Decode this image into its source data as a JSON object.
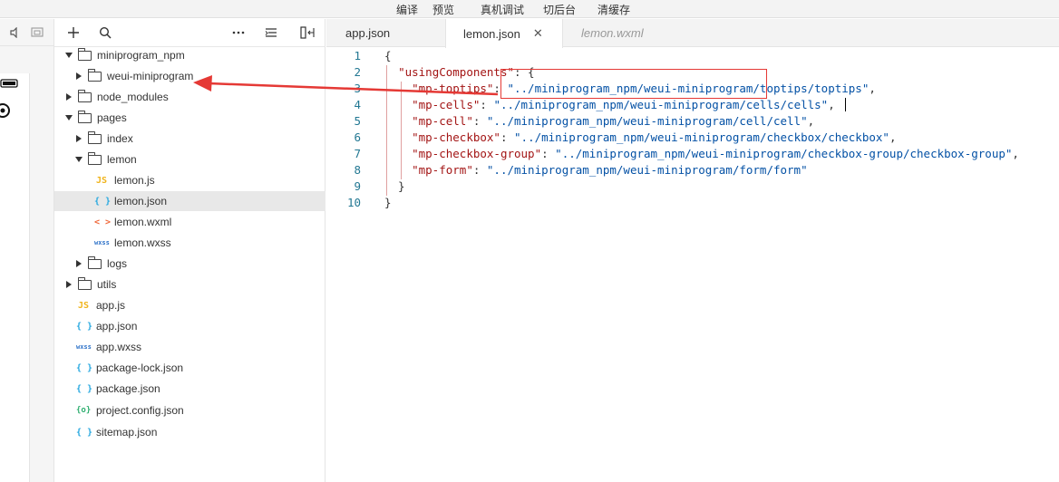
{
  "toolbar": {
    "compile": "编译",
    "preview": "预览",
    "remote_debug": "真机调试",
    "background": "切后台",
    "clear_cache": "清缓存"
  },
  "explorer": {
    "tree": [
      {
        "label": "miniprogram_npm",
        "kind": "folder",
        "expanded": true
      },
      {
        "label": "weui-miniprogram",
        "kind": "folder",
        "expanded": false
      },
      {
        "label": "node_modules",
        "kind": "folder",
        "expanded": false
      },
      {
        "label": "pages",
        "kind": "folder",
        "expanded": true
      },
      {
        "label": "index",
        "kind": "folder",
        "expanded": false
      },
      {
        "label": "lemon",
        "kind": "folder",
        "expanded": true
      },
      {
        "label": "lemon.js",
        "kind": "js",
        "icon_text": "JS"
      },
      {
        "label": "lemon.json",
        "kind": "json",
        "icon_text": "{ }"
      },
      {
        "label": "lemon.wxml",
        "kind": "wxml",
        "icon_text": "< >"
      },
      {
        "label": "lemon.wxss",
        "kind": "wxss",
        "icon_text": "wxss"
      },
      {
        "label": "logs",
        "kind": "folder",
        "expanded": false
      },
      {
        "label": "utils",
        "kind": "folder",
        "expanded": false
      },
      {
        "label": "app.js",
        "kind": "js",
        "icon_text": "JS"
      },
      {
        "label": "app.json",
        "kind": "json",
        "icon_text": "{ }"
      },
      {
        "label": "app.wxss",
        "kind": "wxss",
        "icon_text": "wxss"
      },
      {
        "label": "package-lock.json",
        "kind": "json",
        "icon_text": "{ }"
      },
      {
        "label": "package.json",
        "kind": "json",
        "icon_text": "{ }"
      },
      {
        "label": "project.config.json",
        "kind": "config",
        "icon_text": "{o}"
      },
      {
        "label": "sitemap.json",
        "kind": "json",
        "icon_text": "{ }"
      }
    ]
  },
  "tabs": [
    {
      "label": "app.json",
      "state": "normal"
    },
    {
      "label": "lemon.json",
      "state": "active"
    },
    {
      "label": "lemon.wxml",
      "state": "preview"
    }
  ],
  "editor": {
    "line_numbers": [
      "1",
      "2",
      "3",
      "4",
      "5",
      "6",
      "7",
      "8",
      "9",
      "10"
    ],
    "lines": [
      [
        {
          "t": "{",
          "c": "p"
        }
      ],
      [
        {
          "t": "  ",
          "c": "p"
        },
        {
          "t": "\"usingComponents\"",
          "c": "k"
        },
        {
          "t": ": {",
          "c": "p"
        }
      ],
      [
        {
          "t": "    ",
          "c": "p"
        },
        {
          "t": "\"mp-toptips\"",
          "c": "k"
        },
        {
          "t": ": ",
          "c": "p"
        },
        {
          "t": "\"../miniprogram_npm/weui-miniprogram/toptips/toptips\"",
          "c": "s"
        },
        {
          "t": ",",
          "c": "p"
        }
      ],
      [
        {
          "t": "    ",
          "c": "p"
        },
        {
          "t": "\"mp-cells\"",
          "c": "k"
        },
        {
          "t": ": ",
          "c": "p"
        },
        {
          "t": "\"../miniprogram_npm/weui-miniprogram/cells/cells\"",
          "c": "s"
        },
        {
          "t": ",",
          "c": "p"
        }
      ],
      [
        {
          "t": "    ",
          "c": "p"
        },
        {
          "t": "\"mp-cell\"",
          "c": "k"
        },
        {
          "t": ": ",
          "c": "p"
        },
        {
          "t": "\"../miniprogram_npm/weui-miniprogram/cell/cell\"",
          "c": "s"
        },
        {
          "t": ",",
          "c": "p"
        }
      ],
      [
        {
          "t": "    ",
          "c": "p"
        },
        {
          "t": "\"mp-checkbox\"",
          "c": "k"
        },
        {
          "t": ": ",
          "c": "p"
        },
        {
          "t": "\"../miniprogram_npm/weui-miniprogram/checkbox/checkbox\"",
          "c": "s"
        },
        {
          "t": ",",
          "c": "p"
        }
      ],
      [
        {
          "t": "    ",
          "c": "p"
        },
        {
          "t": "\"mp-checkbox-group\"",
          "c": "k"
        },
        {
          "t": ": ",
          "c": "p"
        },
        {
          "t": "\"../miniprogram_npm/weui-miniprogram/checkbox-group/checkbox-group\"",
          "c": "s"
        },
        {
          "t": ",",
          "c": "p"
        }
      ],
      [
        {
          "t": "    ",
          "c": "p"
        },
        {
          "t": "\"mp-form\"",
          "c": "k"
        },
        {
          "t": ": ",
          "c": "p"
        },
        {
          "t": "\"../miniprogram_npm/weui-miniprogram/form/form\"",
          "c": "s"
        }
      ],
      [
        {
          "t": "  }",
          "c": "p"
        }
      ],
      [
        {
          "t": "}",
          "c": "p"
        }
      ]
    ]
  },
  "annotation": {
    "color": "#e53935"
  }
}
